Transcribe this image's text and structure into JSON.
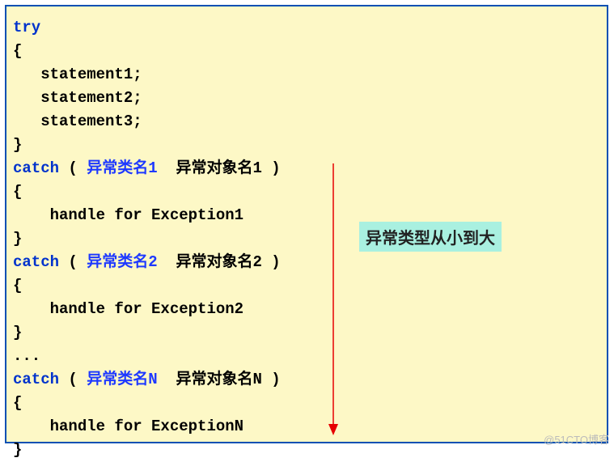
{
  "code": {
    "try_kw": "try",
    "open_brace": "{",
    "stmt1": "   statement1;",
    "stmt2": "   statement2;",
    "stmt3": "   statement3;",
    "close_brace": "}",
    "catch_kw": "catch",
    "paren_open": " ( ",
    "paren_close": " )",
    "exc_class1": "异常类名1",
    "exc_obj1": "  异常对象名1",
    "handle1": "    handle for Exception1",
    "exc_class2": "异常类名2",
    "exc_obj2": "  异常对象名2",
    "handle2": "    handle for Exception2",
    "ellipsis": "...",
    "exc_classN": "异常类名N",
    "exc_objN": "  异常对象名N",
    "handleN": "    handle for ExceptionN"
  },
  "annotation": "异常类型从小到大",
  "watermark": "@51CTO博客"
}
